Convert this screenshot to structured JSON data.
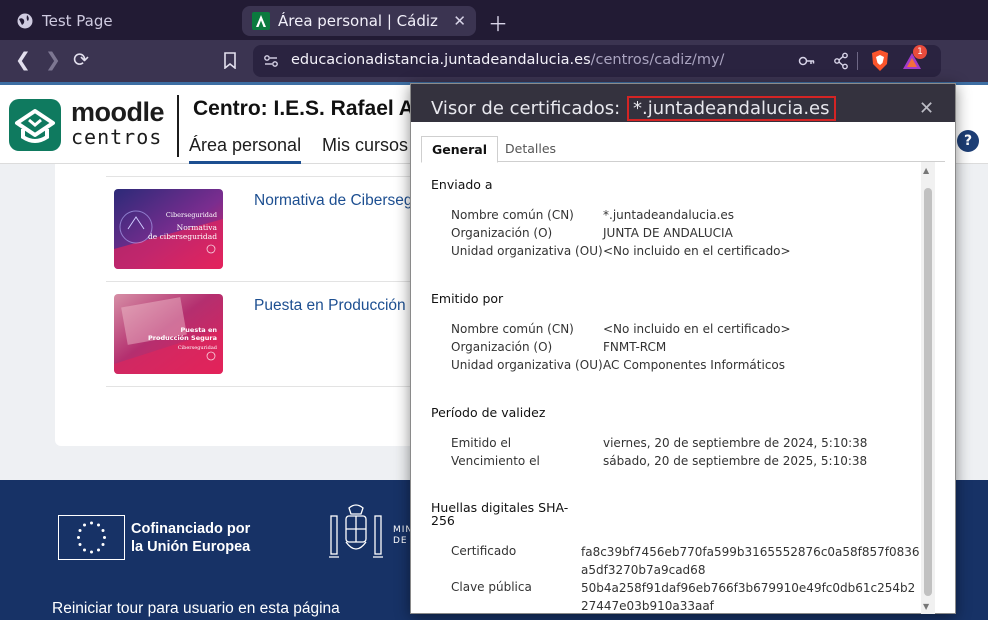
{
  "browser": {
    "tabs": [
      {
        "title": "Test Page",
        "active": false
      },
      {
        "title": "Área personal | Cádiz",
        "active": true
      }
    ],
    "address": {
      "host": "educacionadistancia.juntadeandalucia.es",
      "path": "/centros/cadiz/my/"
    },
    "notification_count": "1"
  },
  "moodle": {
    "logo_line1": "moodle",
    "logo_line2": "centros",
    "centro_title": "Centro:  I.E.S. Rafael Alberti",
    "nav": {
      "active": "Área personal",
      "other": "Mis cursos"
    },
    "help_label": "?"
  },
  "courses": [
    {
      "title": "Normativa de Ciberseguridad",
      "thumb_small": "Ciberseguridad",
      "thumb_big": "Normativa\nde ciberseguridad"
    },
    {
      "title": "Puesta en Producción Segura",
      "thumb_small": "Ciberseguridad",
      "thumb_big": "Puesta en\nProducción Segura"
    }
  ],
  "footer": {
    "eu_line1": "Cofinanciado por",
    "eu_line2": "la Unión Europea",
    "ministerio_line1": "MIN",
    "ministerio_line2": "DE",
    "tour_link": "Reiniciar tour para usuario en esta página"
  },
  "cert_dialog": {
    "title_prefix": "Visor de certificados:",
    "title_domain": "*.juntadeandalucia.es",
    "tabs": [
      "General",
      "Detalles"
    ],
    "issued_to": {
      "heading": "Enviado a",
      "cn_label": "Nombre común (CN)",
      "cn_value": "*.juntadeandalucia.es",
      "o_label": "Organización (O)",
      "o_value": "JUNTA DE ANDALUCIA",
      "ou_label": "Unidad organizativa (OU)",
      "ou_value": "<No incluido en el certificado>"
    },
    "issued_by": {
      "heading": "Emitido por",
      "cn_label": "Nombre común (CN)",
      "cn_value": "<No incluido en el certificado>",
      "o_label": "Organización (O)",
      "o_value": "FNMT-RCM",
      "ou_label": "Unidad organizativa (OU)",
      "ou_value": "AC Componentes Informáticos"
    },
    "validity": {
      "heading": "Período de validez",
      "issued_label": "Emitido el",
      "issued_value": "viernes, 20 de septiembre de 2024, 5:10:38",
      "expires_label": "Vencimiento el",
      "expires_value": "sábado, 20 de septiembre de 2025, 5:10:38"
    },
    "fingerprints": {
      "heading_line1": "Huellas digitales SHA-",
      "heading_line2": "256",
      "cert_label": "Certificado",
      "cert_value": "fa8c39bf7456eb770fa599b3165552876c0a58f857f0836a5df3270b7a9cad68",
      "key_label": "Clave pública",
      "key_value": "50b4a258f91daf96eb766f3b679910e49fc0db61c254b227447e03b910a33aaf"
    }
  }
}
